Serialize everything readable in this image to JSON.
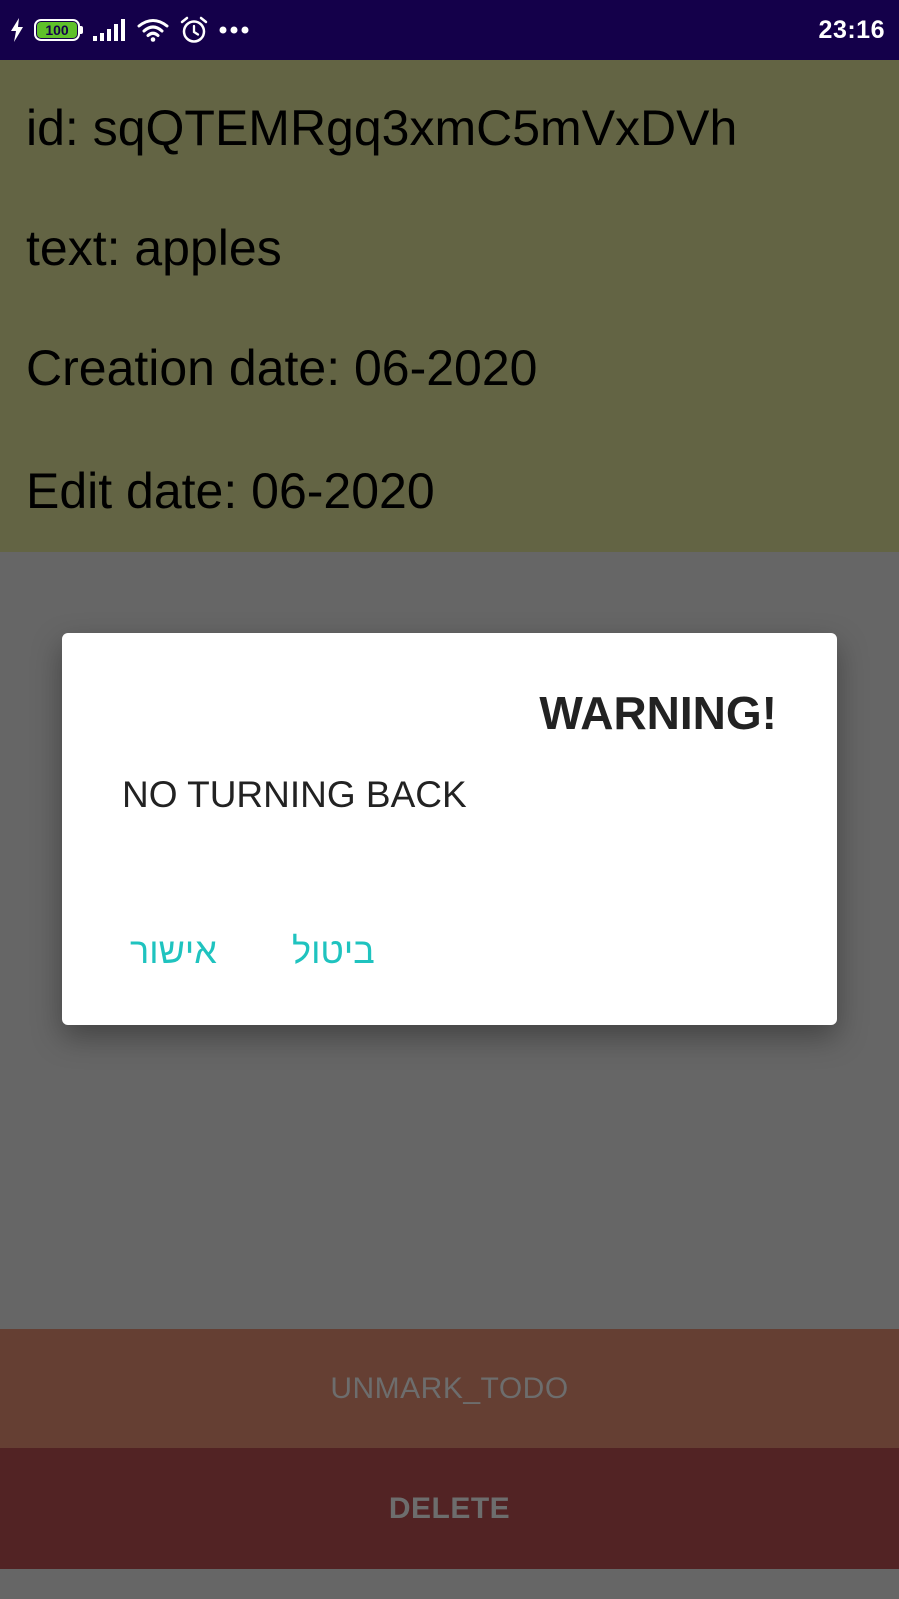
{
  "status_bar": {
    "battery_level": "100",
    "time": "23:16",
    "icons": [
      "charging-bolt-icon",
      "battery-icon",
      "signal-icon",
      "wifi-icon",
      "alarm-icon",
      "more-dots-icon"
    ],
    "colors": {
      "background": "#14004a",
      "battery_fill": "#5fc12a"
    }
  },
  "details": {
    "id_line": "id: sqQTEMRgq3xmC5mVxDVh",
    "text_line": "text: apples",
    "creation_line": "Creation date: 06-2020",
    "edit_line": "Edit date: 06-2020",
    "background_color": "#636444"
  },
  "dialog": {
    "title": "WARNING!",
    "message": "NO TURNING BACK",
    "confirm_label": "אישור",
    "cancel_label": "ביטול",
    "accent_color": "#1fc3bf"
  },
  "actions": {
    "unmark_label": "UNMARK_TODO",
    "delete_label": "DELETE",
    "unmark_color": "#653f33",
    "delete_color": "#522324"
  }
}
